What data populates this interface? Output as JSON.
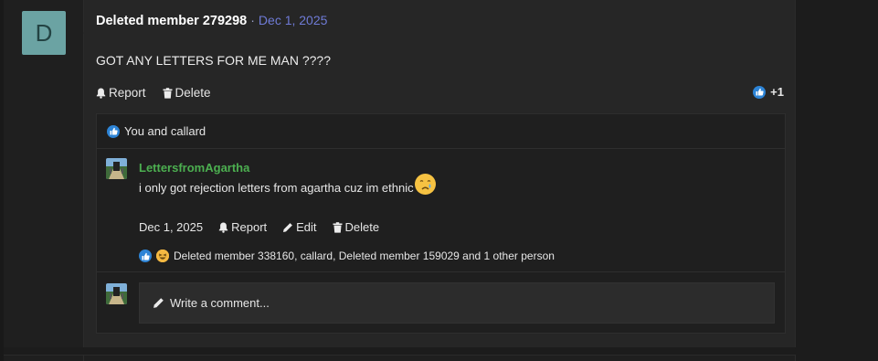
{
  "post": {
    "avatar_letter": "D",
    "author": "Deleted member 279298",
    "separator": "·",
    "date": "Dec 1, 2025",
    "text": "GOT ANY LETTERS FOR ME MAN ????",
    "report_label": "Report",
    "delete_label": "Delete",
    "reaction_count": "+1",
    "reactors": "You and callard"
  },
  "comment": {
    "author": "LettersfromAgartha",
    "text": "i only got rejection letters from agartha cuz im ethnic",
    "date": "Dec 1, 2025",
    "report_label": "Report",
    "edit_label": "Edit",
    "delete_label": "Delete",
    "reactors": "Deleted member 338160, callard, Deleted member 159029 and 1 other person"
  },
  "reply": {
    "placeholder": "Write a comment..."
  },
  "colors": {
    "background": "#1c1c1c",
    "panel": "#262626",
    "avatar_bg": "#6ba3a3",
    "date_link": "#6f7bd6",
    "comment_author": "#4caf50",
    "like_blue": "#2d84d6"
  },
  "icons": [
    "bell-icon",
    "trash-icon",
    "pencil-icon",
    "like-icon",
    "haha-icon",
    "crying-emoji-icon"
  ]
}
